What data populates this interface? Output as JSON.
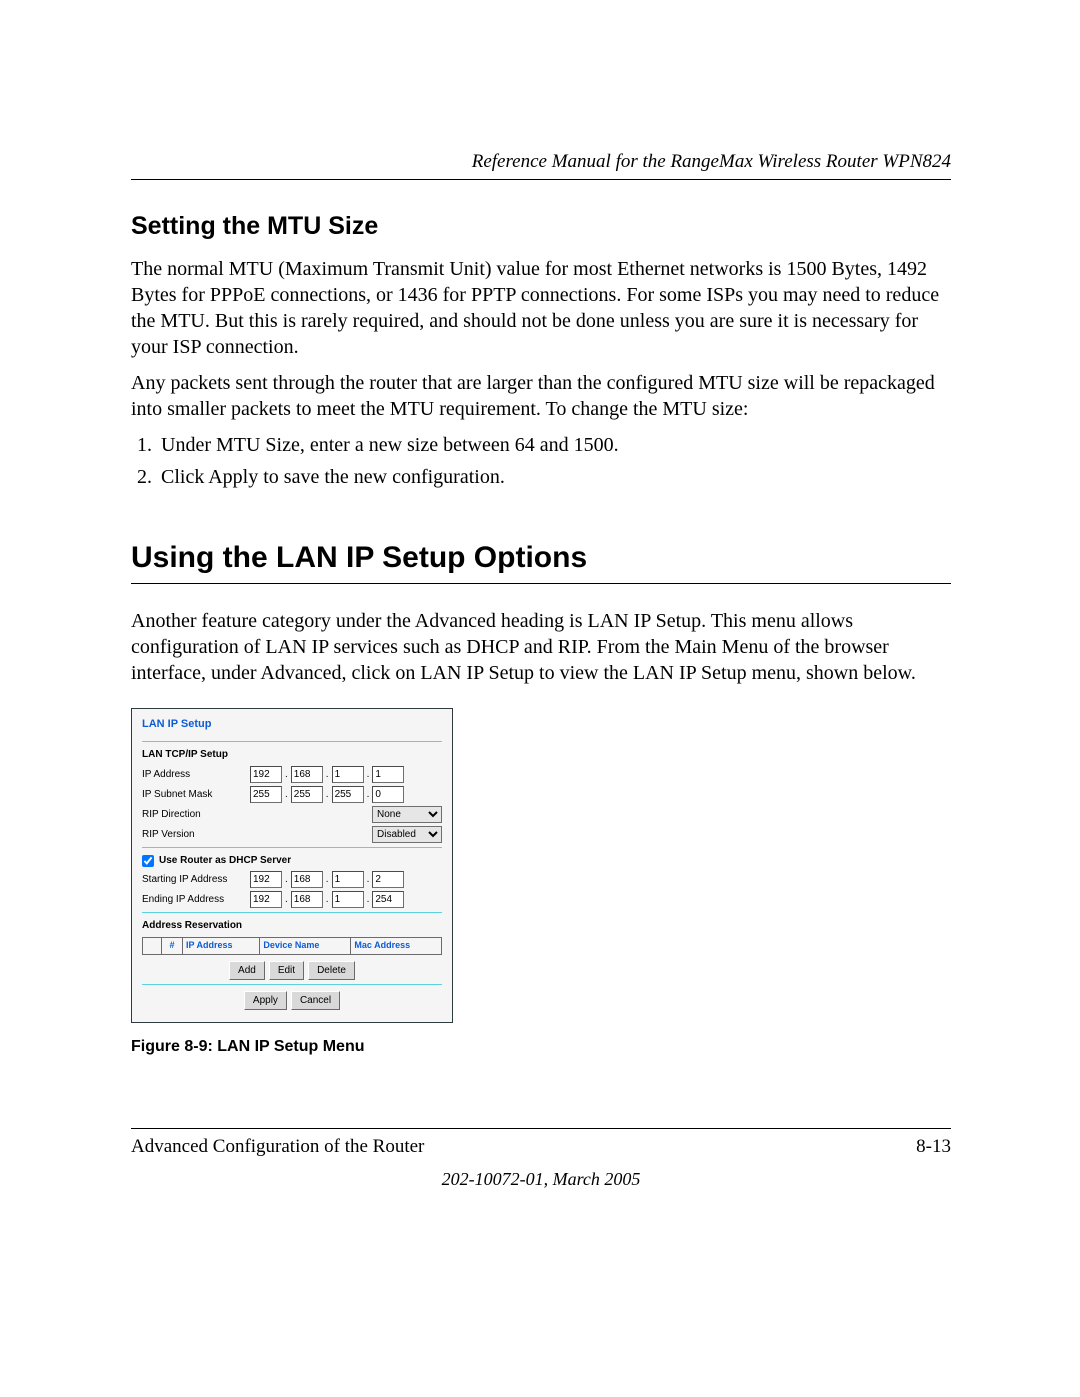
{
  "running_head": "Reference Manual for the RangeMax Wireless Router WPN824",
  "sections": {
    "mtu": {
      "heading": "Setting the MTU Size",
      "p1": "The normal MTU (Maximum Transmit Unit) value for most Ethernet networks is 1500 Bytes, 1492 Bytes for PPPoE connections, or 1436 for PPTP connections. For some ISPs you may need to reduce the MTU. But this is rarely required, and should not be done unless you are sure it is necessary for your ISP connection.",
      "p2": "Any packets sent through the router that are larger than the configured MTU size will be repackaged into smaller packets to meet the MTU requirement. To change the MTU size:",
      "steps": [
        "Under MTU Size, enter a new size between 64 and 1500.",
        "Click Apply to save the new configuration."
      ]
    },
    "lanip": {
      "heading": "Using the LAN IP Setup Options",
      "p1": "Another feature category under the Advanced heading is LAN IP Setup. This menu allows configuration of LAN IP services such as DHCP and RIP. From the Main Menu of the browser interface, under Advanced, click on LAN IP Setup to view the LAN IP Setup menu, shown below."
    }
  },
  "screenshot": {
    "title": "LAN IP Setup",
    "tcpip": {
      "heading": "LAN TCP/IP Setup",
      "ip_label": "IP Address",
      "ip": [
        "192",
        "168",
        "1",
        "1"
      ],
      "mask_label": "IP Subnet Mask",
      "mask": [
        "255",
        "255",
        "255",
        "0"
      ],
      "rip_dir_label": "RIP Direction",
      "rip_dir_value": "None",
      "rip_ver_label": "RIP Version",
      "rip_ver_value": "Disabled"
    },
    "dhcp": {
      "checkbox_label": "Use Router as DHCP Server",
      "checked": true,
      "start_label": "Starting IP Address",
      "start": [
        "192",
        "168",
        "1",
        "2"
      ],
      "end_label": "Ending IP Address",
      "end": [
        "192",
        "168",
        "1",
        "254"
      ]
    },
    "reservation": {
      "heading": "Address Reservation",
      "cols": {
        "num": "#",
        "ip": "IP Address",
        "dev": "Device Name",
        "mac": "Mac Address"
      },
      "btn_add": "Add",
      "btn_edit": "Edit",
      "btn_delete": "Delete"
    },
    "main_buttons": {
      "apply": "Apply",
      "cancel": "Cancel"
    }
  },
  "figure_caption": "Figure 8-9:  LAN IP Setup Menu",
  "footer": {
    "chapter": "Advanced Configuration of the Router",
    "page": "8-13",
    "docid": "202-10072-01, March 2005"
  }
}
